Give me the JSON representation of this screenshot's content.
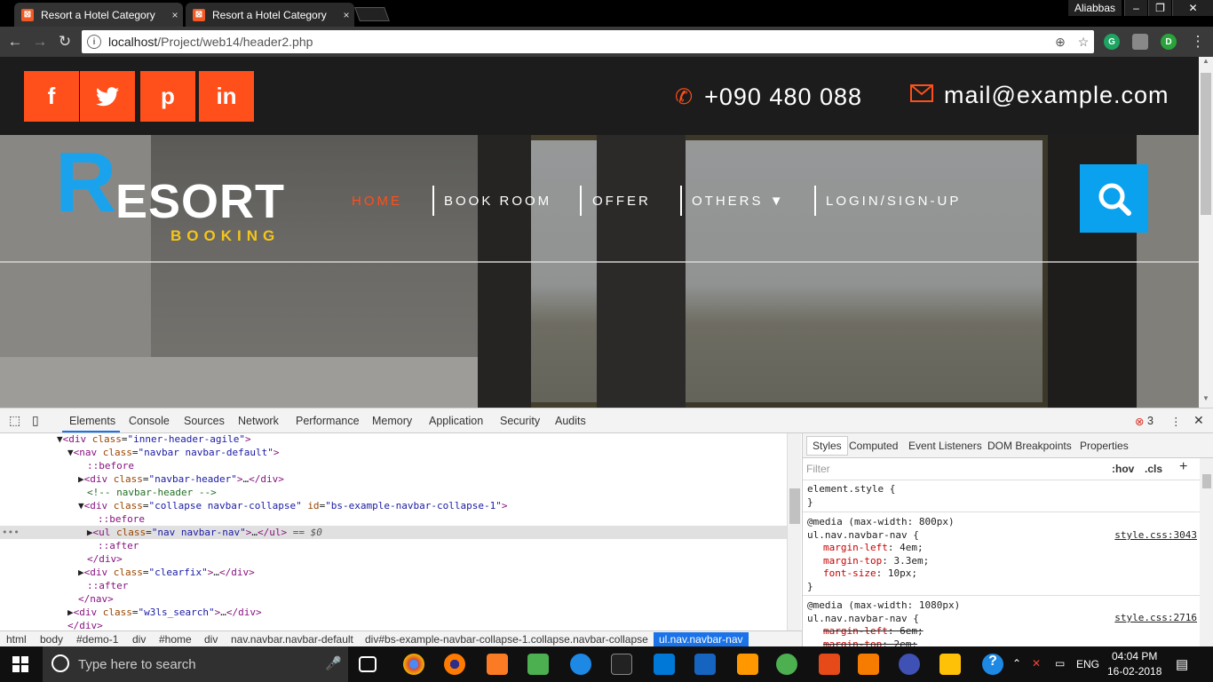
{
  "browser": {
    "tabs": [
      {
        "title": "Resort a Hotel Category",
        "close": "×"
      },
      {
        "title": "Resort a Hotel Category",
        "close": "×"
      }
    ],
    "user": "Aliabbas",
    "window_controls": [
      "–",
      "❐",
      "✕"
    ],
    "url_host": "localhost",
    "url_path": "/Project/web14/header2.php",
    "extensions": [
      "G",
      "",
      "D"
    ]
  },
  "page": {
    "social": [
      {
        "icon": "facebook-icon",
        "glyph": "f"
      },
      {
        "icon": "twitter-icon",
        "glyph": "🐦"
      },
      {
        "icon": "pinterest-icon",
        "glyph": "p"
      },
      {
        "icon": "linkedin-icon",
        "glyph": "in"
      }
    ],
    "phone": "+090 480 088",
    "email": "mail@example.com",
    "logo": {
      "first": "R",
      "rest": "ESORT",
      "sub": "BOOKING"
    },
    "menu": [
      "HOME",
      "BOOK ROOM",
      "OFFER",
      "OTHERS",
      "LOGIN/SIGN-UP"
    ],
    "accent": "#ff4f1a",
    "brand_blue": "#1aa3ec",
    "logo_yellow": "#f5c518"
  },
  "devtools": {
    "tabs": [
      "Elements",
      "Console",
      "Sources",
      "Network",
      "Performance",
      "Memory",
      "Application",
      "Security",
      "Audits"
    ],
    "error_count": "3",
    "breadcrumbs": [
      "html",
      "body",
      "#demo-1",
      "div",
      "#home",
      "div",
      "nav.navbar.navbar-default",
      "div#bs-example-navbar-collapse-1.collapse.navbar-collapse",
      "ul.nav.navbar-nav"
    ],
    "styles_tabs": [
      "Styles",
      "Computed",
      "Event Listeners",
      "DOM Breakpoints",
      "Properties"
    ],
    "filter_placeholder": "Filter",
    "hov": ":hov",
    "cls": ".cls",
    "element_style": "element.style {",
    "close_brace": "}",
    "rule1": {
      "media": "@media (max-width: 800px)",
      "selector": "ul.nav.navbar-nav {",
      "source": "style.css:3043",
      "props": [
        [
          "margin-left",
          "4em;"
        ],
        [
          "margin-top",
          "3.3em;"
        ],
        [
          "font-size",
          "10px;"
        ]
      ]
    },
    "rule2": {
      "media": "@media (max-width: 1080px)",
      "selector": "ul.nav.navbar-nav {",
      "source": "style.css:2716",
      "props": [
        [
          "margin-left",
          "6em;"
        ],
        [
          "margin-top",
          "2em;"
        ]
      ]
    }
  },
  "taskbar": {
    "search_placeholder": "Type here to search",
    "lang": "ENG",
    "time": "04:04 PM",
    "date": "16-02-2018"
  }
}
